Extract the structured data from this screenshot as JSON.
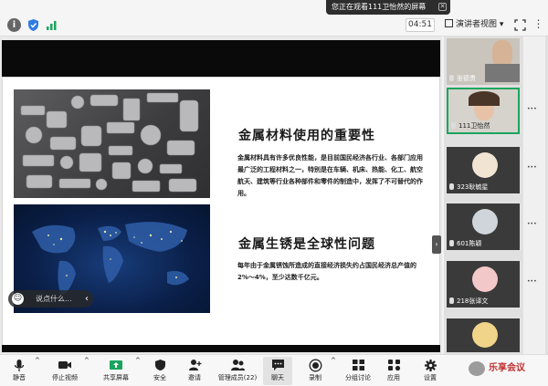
{
  "notice": {
    "text": "您正在观看111卫怡然的屏幕"
  },
  "toolbar": {
    "timer": "04:51",
    "presenter_view": "演讲者视图"
  },
  "slide": {
    "heading1": "金属材料使用的重要性",
    "para1": "金属材料具有许多优良性能，是目前国民经济各行业、各部门应用最广泛的工程材料之一，特别是在车辆、机床、热能、化工、航空航天、建筑等行业各种部件和零件的制造中，发挥了不可替代的作用。",
    "heading2": "金属生锈是全球性问题",
    "para2": "每年由于金属锈蚀所造成的直接经济损失约占国民经济总产值的2%～4%，至少达数千亿元。"
  },
  "chat": {
    "placeholder": "说点什么..."
  },
  "participants": [
    {
      "name": "张德贵",
      "active": false
    },
    {
      "name": "111卫怡然",
      "active": true
    },
    {
      "name": "323耿毓星",
      "active": false
    },
    {
      "name": "601陈颖",
      "active": false
    },
    {
      "name": "218张译文",
      "active": false
    }
  ],
  "bottombar": {
    "mute": "静音",
    "stop_video": "停止视频",
    "share_screen": "共享屏幕",
    "security": "安全",
    "invite": "邀请",
    "manage_members": "管理成员(22)",
    "chat": "聊天",
    "record": "录制",
    "breakout": "分组讨论",
    "apps": "应用",
    "settings": "设置"
  },
  "watermark": {
    "text": "乐享会议"
  },
  "colors": {
    "active_border": "#1aa55e",
    "slide_bg": "#ffffff",
    "bar_black": "#0a0a0a"
  }
}
